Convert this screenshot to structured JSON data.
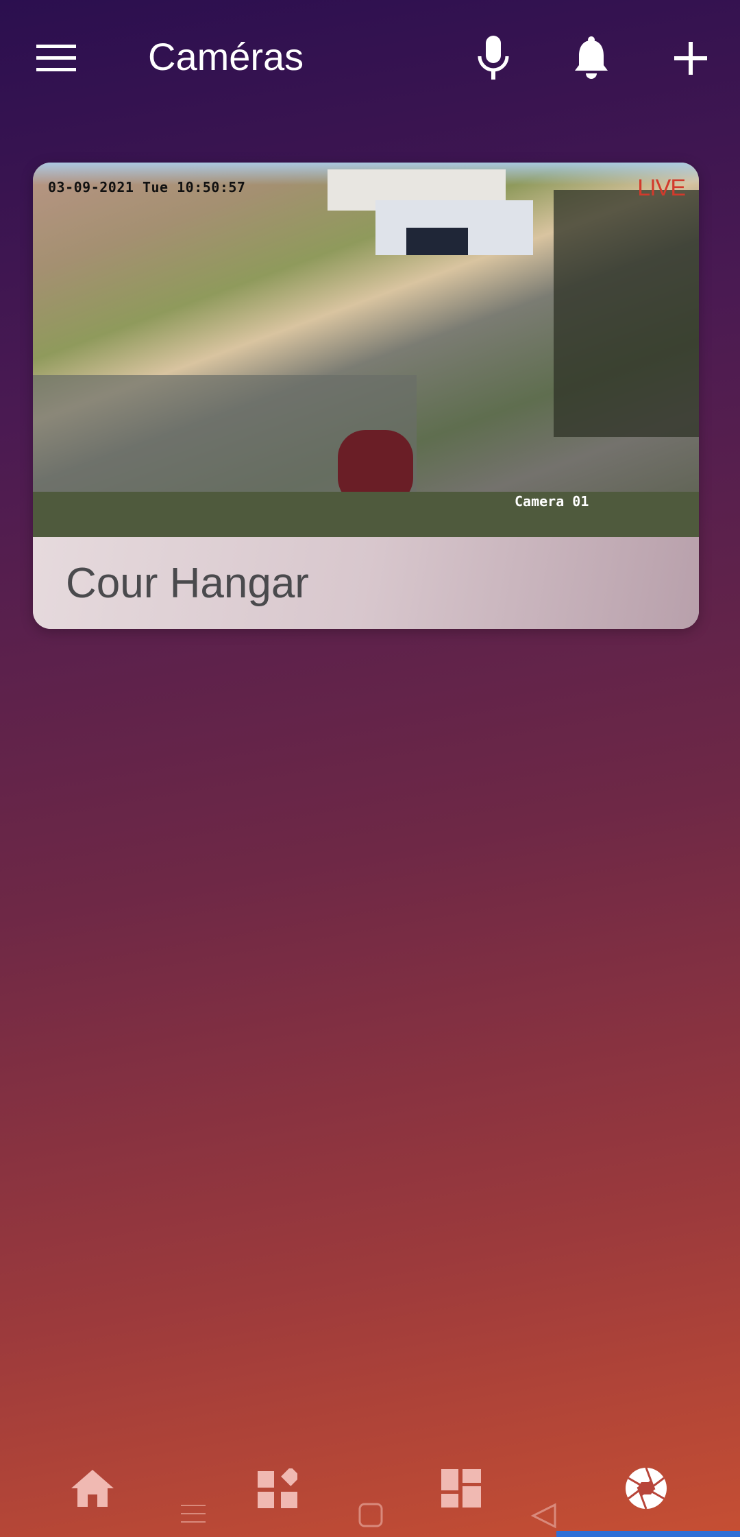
{
  "header": {
    "title": "Caméras",
    "icons": [
      "menu-icon",
      "microphone-icon",
      "bell-icon",
      "plus-icon"
    ]
  },
  "camera_card": {
    "name": "Cour Hangar",
    "osd_datetime": "03-09-2021 Tue 10:50:57",
    "live_label": "LIVE",
    "camera_label": "Camera 01"
  },
  "bottom_nav": {
    "items": [
      "home-icon",
      "widgets-icon",
      "dashboard-icon",
      "camera-shutter-icon"
    ],
    "active": "camera-shutter-icon"
  },
  "system_nav": [
    "recent-apps-icon",
    "home-square-icon",
    "back-triangle-icon"
  ],
  "colors": {
    "live": "#d23a2c",
    "active_indicator": "#2e6fd6"
  }
}
